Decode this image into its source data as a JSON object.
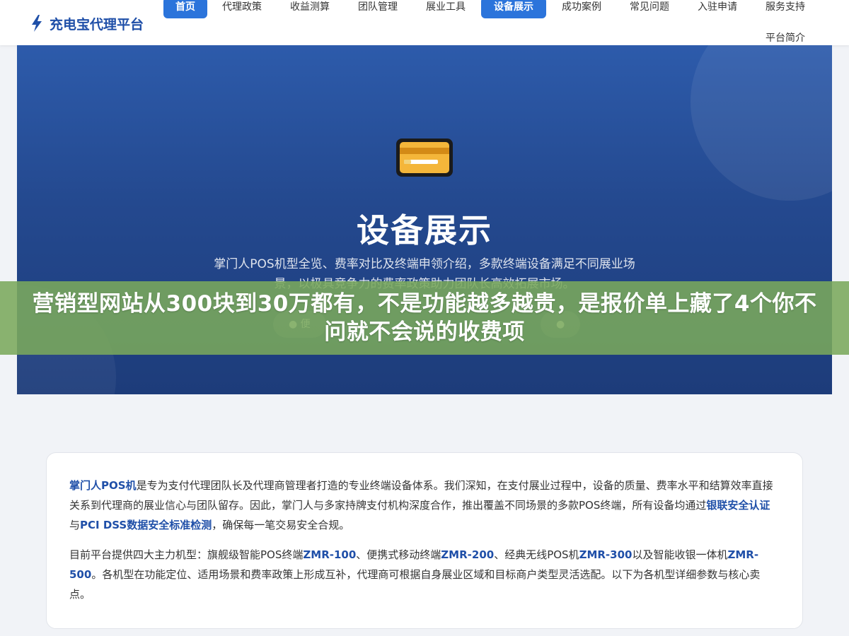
{
  "header": {
    "logo_text": "充电宝代理平台",
    "logo_icon": "lightning-bolt-icon",
    "nav": [
      {
        "label": "首页",
        "active": true
      },
      {
        "label": "代理政策",
        "active": false
      },
      {
        "label": "收益测算",
        "active": false
      },
      {
        "label": "团队管理",
        "active": false
      },
      {
        "label": "展业工具",
        "active": false
      },
      {
        "label": "设备展示",
        "active": true
      },
      {
        "label": "成功案例",
        "active": false
      },
      {
        "label": "常见问题",
        "active": false
      },
      {
        "label": "入驻申请",
        "active": false
      },
      {
        "label": "服务支持",
        "active": false
      },
      {
        "label": "平台简介",
        "active": false
      }
    ]
  },
  "hero": {
    "icon": "credit-card-icon",
    "title": "设备展示",
    "subtitle": "掌门人POS机型全览、费率对比及终端申领介绍，多款终端设备满足不同展业场景，以极具竞争力的费率政策助力团队长高效拓展市场。",
    "btn_left": "● 便",
    "btn_right": "●"
  },
  "banner": {
    "text": "营销型网站从300块到30万都有，不是功能越多越贵，是报价单上藏了4个你不问就不会说的收费项"
  },
  "content": {
    "p1": {
      "s1": "掌门人POS机",
      "s2": "是专为支付代理团队长及代理商管理者打造的专业终端设备体系。我们深知，在支付展业过程中，设备的质量、费率水平和结算效率直接关系到代理商的展业信心与团队留存。因此，掌门人与多家持牌支付机构深度合作，推出覆盖不同场景的多款POS终端，所有设备均通过",
      "s3": "银联安全认证",
      "s4": "与",
      "s5": "PCI DSS数据安全标准检测",
      "s6": "，确保每一笔交易安全合规。"
    },
    "p2": {
      "s1": "目前平台提供四大主力机型：旗舰级智能POS终端",
      "s2": "ZMR-100",
      "s3": "、便携式移动终端",
      "s4": "ZMR-200",
      "s5": "、经典无线POS机",
      "s6": "ZMR-300",
      "s7": "以及智能收银一体机",
      "s8": "ZMR-500",
      "s9": "。各机型在功能定位、适用场景和费率政策上形成互补，代理商可根据自身展业区域和目标商户类型灵活选配。以下为各机型详细参数与核心卖点。"
    }
  },
  "colors": {
    "brand": "#1f4fa8",
    "nav_active": "#2b74db",
    "hero_bg": "#24498f",
    "banner_bg": "#7aa85c"
  }
}
